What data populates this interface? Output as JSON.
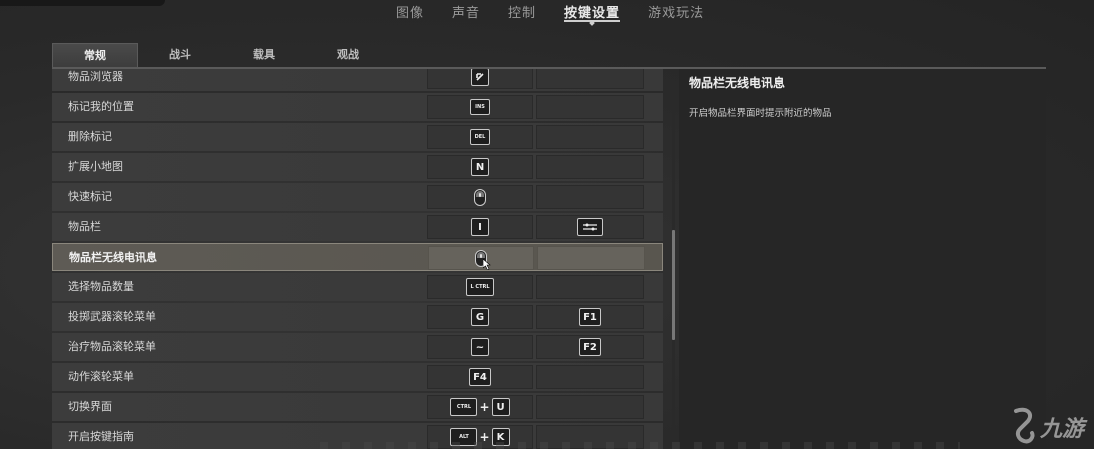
{
  "top_tabs": [
    "图像",
    "声音",
    "控制",
    "按键设置",
    "游戏玩法"
  ],
  "active_top_tab": "按键设置",
  "sub_tabs": [
    "常规",
    "战斗",
    "载具",
    "观战"
  ],
  "active_sub_tab": "常规",
  "rows": [
    {
      "label": "物品浏览器",
      "key1": "nav-arrow-icon",
      "key2": ""
    },
    {
      "label": "标记我的位置",
      "key1": "INS",
      "key2": ""
    },
    {
      "label": "删除标记",
      "key1": "DEL",
      "key2": ""
    },
    {
      "label": "扩展小地图",
      "key1": "N",
      "key2": ""
    },
    {
      "label": "快速标记",
      "key1": "mouse-middle-icon",
      "key2": ""
    },
    {
      "label": "物品栏",
      "key1": "I",
      "key2": "gamepad-menu-icon"
    },
    {
      "label": "物品栏无线电讯息",
      "key1": "mouse-middle-icon",
      "key2": "",
      "selected": true
    },
    {
      "label": "选择物品数量",
      "key1": "L CTRL",
      "key2": ""
    },
    {
      "label": "投掷武器滚轮菜单",
      "key1": "G",
      "key2": "F1"
    },
    {
      "label": "治疗物品滚轮菜单",
      "key1": "~",
      "key2": "F2"
    },
    {
      "label": "动作滚轮菜单",
      "key1": "F4",
      "key2": ""
    },
    {
      "label": "切换界面",
      "key1_combo": [
        "CTRL",
        "U"
      ],
      "key2": ""
    },
    {
      "label": "开启按键指南",
      "key1_combo": [
        "ALT",
        "K"
      ],
      "key2": ""
    }
  ],
  "detail": {
    "title": "物品栏无线电讯息",
    "description": "开启物品栏界面时提示附近的物品"
  },
  "watermark": {
    "text": "九游"
  },
  "colors": {
    "background": "#2d2d2d",
    "row": "#3c3c3c",
    "selected_row": "#5e5b55",
    "detail_panel": "#262626"
  }
}
